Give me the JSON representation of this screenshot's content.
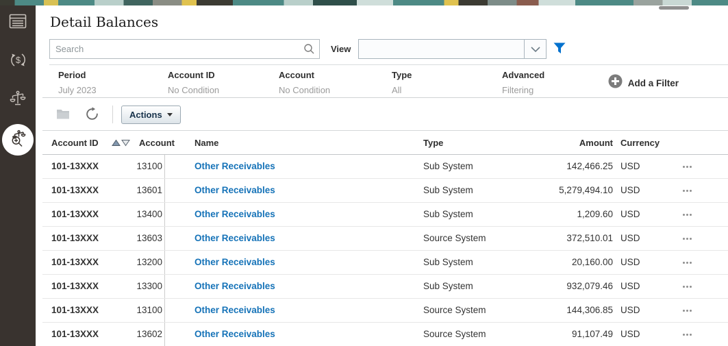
{
  "page": {
    "title": "Detail Balances"
  },
  "sidebar": {
    "items": [
      {
        "id": "balances-list",
        "icon": "ledger-grid-icon",
        "active": false
      },
      {
        "id": "currency-exchange",
        "icon": "currency-transfer-icon",
        "active": false
      },
      {
        "id": "balance-hierarchy",
        "icon": "scales-icon",
        "active": false
      },
      {
        "id": "balance-inquiry",
        "icon": "scales-search-icon",
        "active": true
      }
    ]
  },
  "search": {
    "placeholder": "Search"
  },
  "view": {
    "label": "View",
    "value": ""
  },
  "filter_bar": {
    "fields": [
      {
        "label": "Period",
        "value": "July 2023"
      },
      {
        "label": "Account ID",
        "value": "No Condition"
      },
      {
        "label": "Account",
        "value": "No Condition"
      },
      {
        "label": "Type",
        "value": "All"
      },
      {
        "label": "Advanced",
        "value": "Filtering"
      }
    ],
    "add_filter_label": "Add a Filter"
  },
  "toolbar": {
    "actions_label": "Actions"
  },
  "table": {
    "headers": {
      "account_id": "Account ID",
      "account": "Account",
      "name": "Name",
      "type": "Type",
      "amount": "Amount",
      "currency": "Currency"
    },
    "rows": [
      {
        "account_id": "101-13XXX",
        "account": "13100",
        "name": "Other Receivables",
        "type": "Sub System",
        "amount": "142,466.25",
        "currency": "USD"
      },
      {
        "account_id": "101-13XXX",
        "account": "13601",
        "name": "Other Receivables",
        "type": "Sub System",
        "amount": "5,279,494.10",
        "currency": "USD"
      },
      {
        "account_id": "101-13XXX",
        "account": "13400",
        "name": "Other Receivables",
        "type": "Sub System",
        "amount": "1,209.60",
        "currency": "USD"
      },
      {
        "account_id": "101-13XXX",
        "account": "13603",
        "name": "Other Receivables",
        "type": "Source System",
        "amount": "372,510.01",
        "currency": "USD"
      },
      {
        "account_id": "101-13XXX",
        "account": "13200",
        "name": "Other Receivables",
        "type": "Sub System",
        "amount": "20,160.00",
        "currency": "USD"
      },
      {
        "account_id": "101-13XXX",
        "account": "13300",
        "name": "Other Receivables",
        "type": "Sub System",
        "amount": "932,079.46",
        "currency": "USD"
      },
      {
        "account_id": "101-13XXX",
        "account": "13100",
        "name": "Other Receivables",
        "type": "Source System",
        "amount": "144,306.85",
        "currency": "USD"
      },
      {
        "account_id": "101-13XXX",
        "account": "13602",
        "name": "Other Receivables",
        "type": "Source System",
        "amount": "91,107.49",
        "currency": "USD"
      }
    ]
  },
  "icons": {
    "search-icon": "magnifier",
    "chevron-down-icon": "v-chevron",
    "filter-funnel-icon": "funnel",
    "add-circle-icon": "plus-in-circle",
    "folder-icon": "folder",
    "refresh-icon": "circular-arrow",
    "dropdown-caret-icon": "▾",
    "sort-ascending-icon": "▲",
    "sort-descending-icon": "▽",
    "row-actions-icon": "•••",
    "ledger-grid-icon": "table-grid",
    "currency-transfer-icon": "dollar-exchange",
    "scales-icon": "balance-scale",
    "scales-search-icon": "balance-scale-magnifier"
  },
  "colors": {
    "accent_blue": "#0572ce",
    "link_blue": "#1673b8",
    "sidebar_bg": "#39332f",
    "add_circle_gray": "#7c7c7c"
  }
}
